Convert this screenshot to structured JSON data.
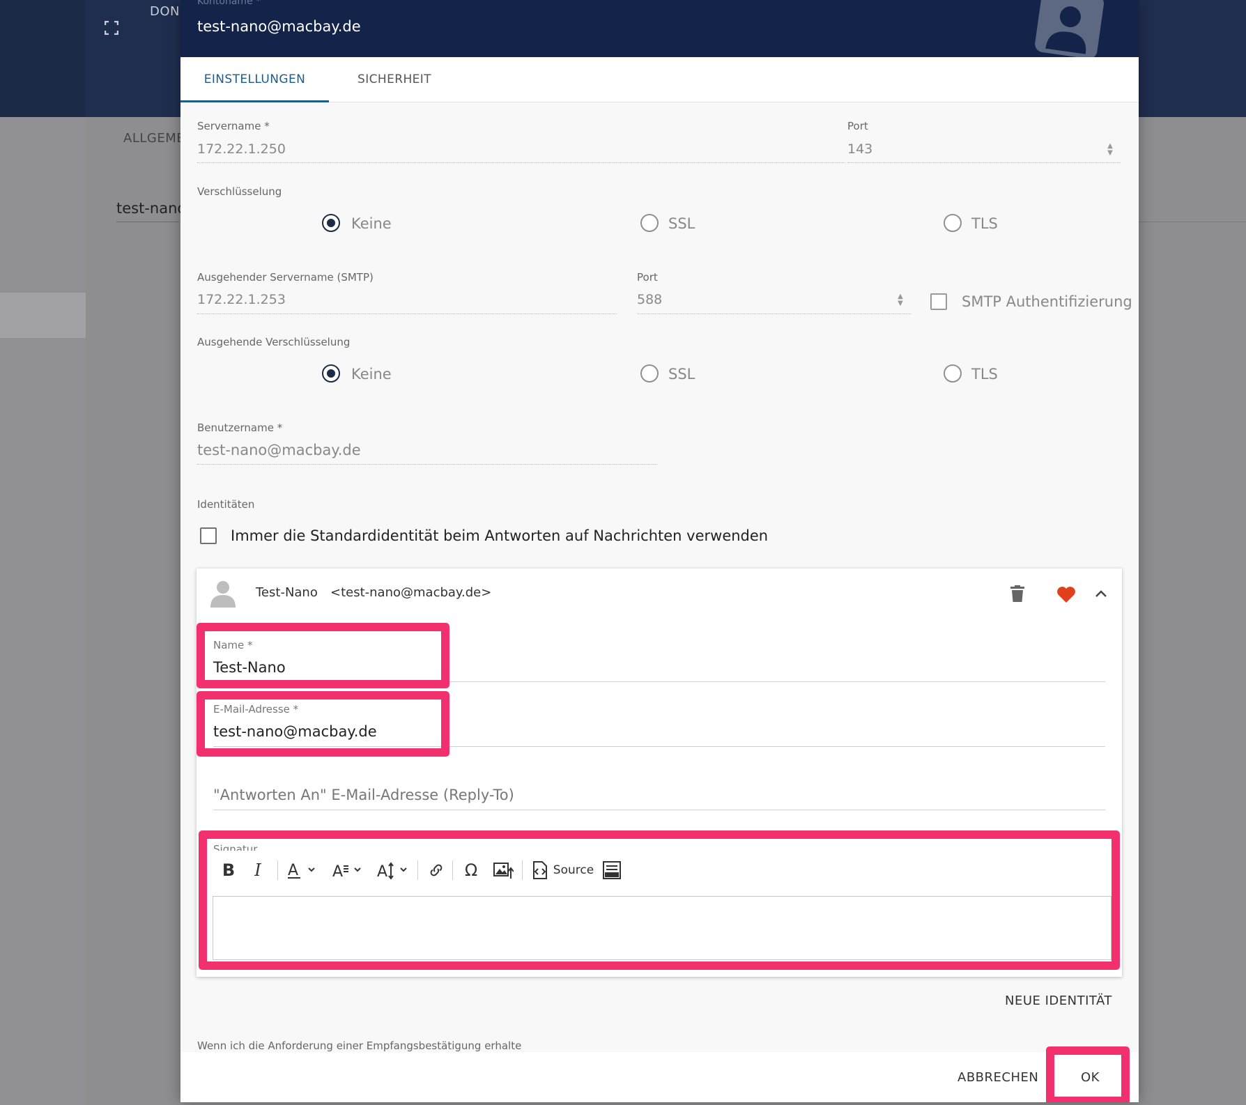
{
  "background": {
    "header_text": "DON",
    "tab_label": "ALLGEME",
    "account_text": "test-nano"
  },
  "dialog": {
    "header": {
      "label": "Kontoname *",
      "value": "test-nano@macbay.de"
    },
    "tabs": [
      {
        "label": "EINSTELLUNGEN",
        "active": true
      },
      {
        "label": "SICHERHEIT",
        "active": false
      }
    ],
    "incoming": {
      "server_label": "Servername *",
      "server_value": "172.22.1.250",
      "port_label": "Port",
      "port_value": "143",
      "encryption_label": "Verschlüsselung",
      "encryption_options": [
        "Keine",
        "SSL",
        "TLS"
      ],
      "encryption_selected": "Keine"
    },
    "outgoing": {
      "server_label": "Ausgehender Servername (SMTP)",
      "server_value": "172.22.1.253",
      "port_label": "Port",
      "port_value": "588",
      "auth_label": "SMTP Authentifizierung",
      "encryption_label": "Ausgehende Verschlüsselung",
      "encryption_options": [
        "Keine",
        "SSL",
        "TLS"
      ],
      "encryption_selected": "Keine"
    },
    "username_label": "Benutzername *",
    "username_value": "test-nano@macbay.de",
    "identities": {
      "section_label": "Identitäten",
      "default_checkbox_label": "Immer die Standardidentität beim Antworten auf Nachrichten verwenden",
      "card": {
        "display_name": "Test-Nano",
        "display_email": "<test-nano@macbay.de>",
        "name_label": "Name *",
        "name_value": "Test-Nano",
        "email_label": "E-Mail-Adresse *",
        "email_value": "test-nano@macbay.de",
        "reply_to_placeholder": "\"Antworten An\" E-Mail-Adresse (Reply-To)",
        "signature_label": "Signatur",
        "toolbar_source_label": "Source"
      },
      "new_identity_label": "NEUE IDENTITÄT"
    },
    "receipt_label": "Wenn ich die Anforderung einer Empfangsbestätigung erhalte",
    "cancel_label": "ABBRECHEN",
    "ok_label": "OK"
  },
  "colors": {
    "header_bg": "#13234a",
    "accent": "#1c5c8a",
    "highlight": "#f2306e",
    "favorite": "#e0401c"
  }
}
